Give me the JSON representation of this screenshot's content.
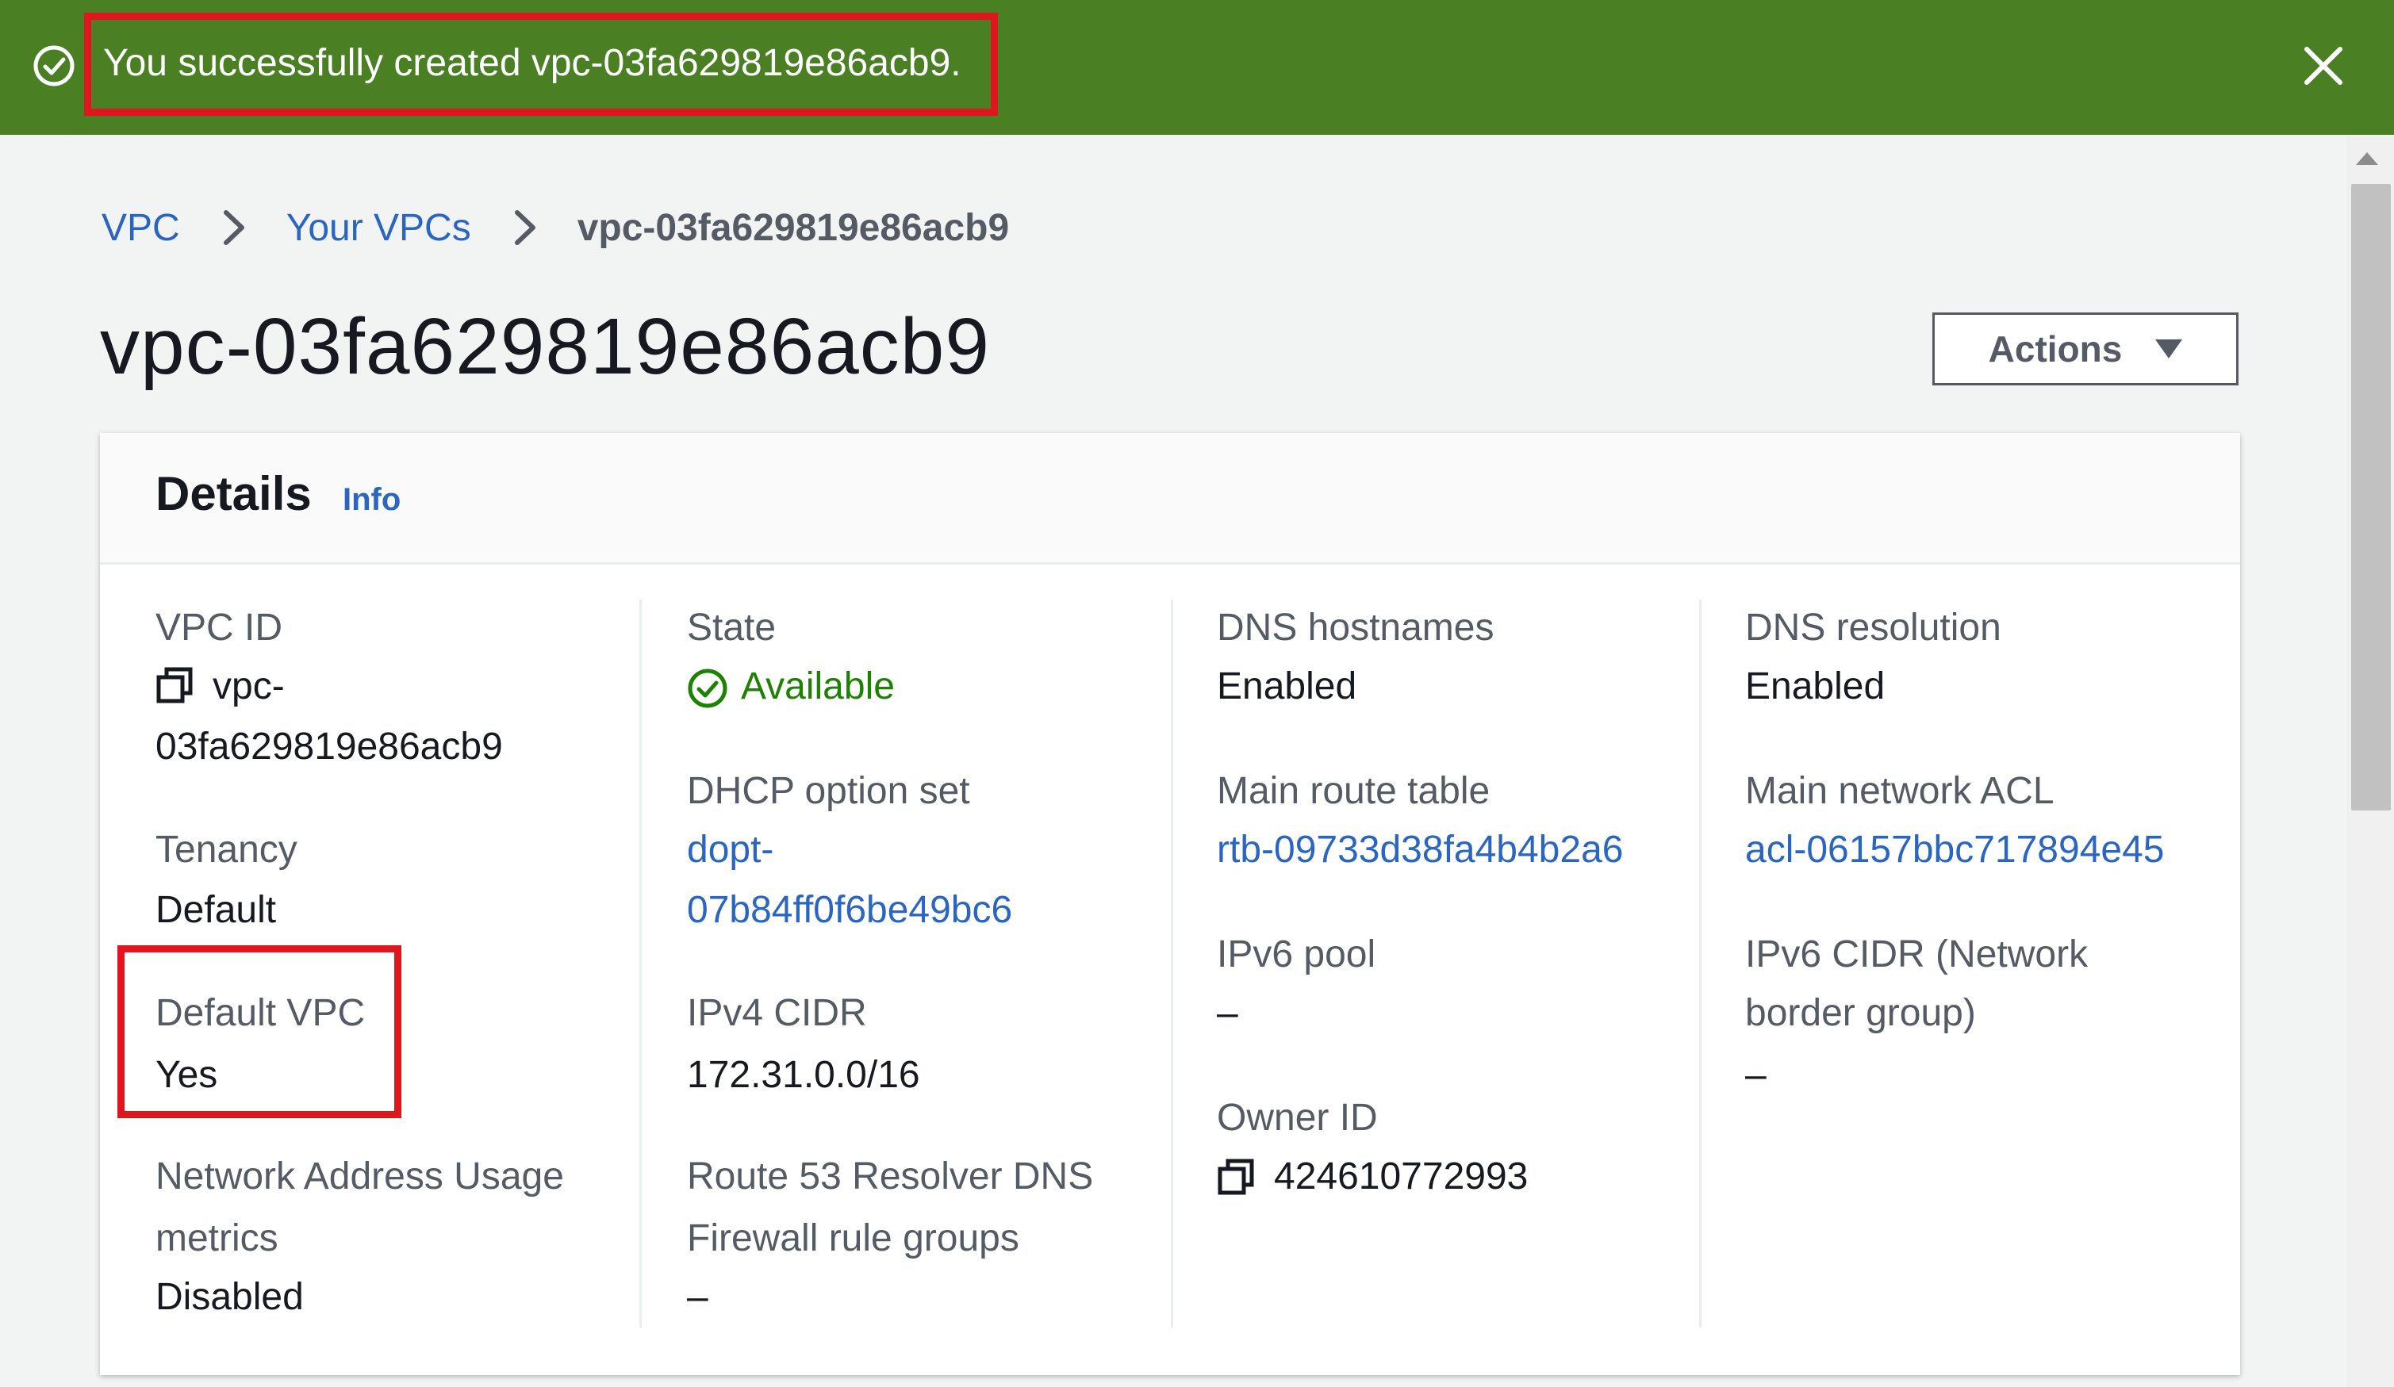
{
  "flash": {
    "message": "You successfully created vpc-03fa629819e86acb9.",
    "color": "#4a7f24"
  },
  "breadcrumb": {
    "items": [
      "VPC",
      "Your VPCs"
    ],
    "current": "vpc-03fa629819e86acb9"
  },
  "page": {
    "title": "vpc-03fa629819e86acb9",
    "actions_label": "Actions"
  },
  "details": {
    "title": "Details",
    "info_label": "Info",
    "vpc_id": {
      "label": "VPC ID",
      "line1": "vpc-",
      "line2": "03fa629819e86acb9"
    },
    "tenancy": {
      "label": "Tenancy",
      "value": "Default"
    },
    "default_vpc": {
      "label": "Default VPC",
      "value": "Yes"
    },
    "network_address_usage": {
      "label_line1": "Network Address Usage",
      "label_line2": "metrics",
      "value": "Disabled"
    },
    "state": {
      "label": "State",
      "value": "Available"
    },
    "dhcp": {
      "label": "DHCP option set",
      "line1": "dopt-",
      "line2": "07b84ff0f6be49bc6"
    },
    "ipv4_cidr": {
      "label": "IPv4 CIDR",
      "value": "172.31.0.0/16"
    },
    "route53": {
      "label_line1": "Route 53 Resolver DNS",
      "label_line2": "Firewall rule groups",
      "value": "–"
    },
    "dns_hostnames": {
      "label": "DNS hostnames",
      "value": "Enabled"
    },
    "main_route_table": {
      "label": "Main route table",
      "value": "rtb-09733d38fa4b4b2a6"
    },
    "ipv6_pool": {
      "label": "IPv6 pool",
      "value": "–"
    },
    "owner_id": {
      "label": "Owner ID",
      "value": "424610772993"
    },
    "dns_resolution": {
      "label": "DNS resolution",
      "value": "Enabled"
    },
    "main_network_acl": {
      "label": "Main network ACL",
      "value": "acl-06157bbc717894e45"
    },
    "ipv6_cidr": {
      "label_line1": "IPv6 CIDR (Network",
      "label_line2": "border group)",
      "value": "–"
    }
  },
  "colors": {
    "link": "#2a66c1",
    "success": "#1d8102",
    "highlight": "#e0161f"
  }
}
